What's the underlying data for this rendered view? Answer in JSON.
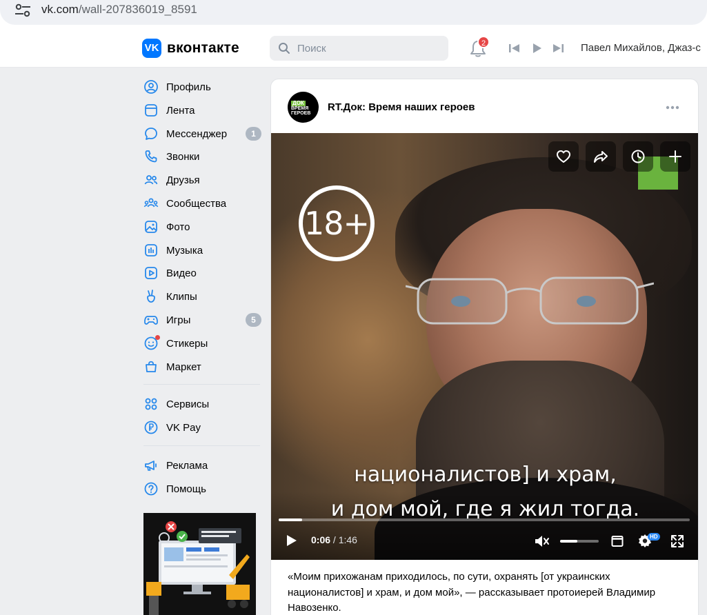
{
  "browser": {
    "url_host": "vk.com",
    "url_path": "/wall-207836019_8591"
  },
  "header": {
    "logo_glyph": "VK",
    "wordmark": "вконтакте",
    "search_placeholder": "Поиск",
    "notifications_count": "2",
    "now_playing": "Павел Михайлов, Джаз-с"
  },
  "sidebar": {
    "items": [
      {
        "label": "Профиль",
        "icon": "user-circle-icon"
      },
      {
        "label": "Лента",
        "icon": "newsfeed-icon"
      },
      {
        "label": "Мессенджер",
        "icon": "message-icon",
        "count": "1"
      },
      {
        "label": "Звонки",
        "icon": "phone-icon"
      },
      {
        "label": "Друзья",
        "icon": "friends-icon"
      },
      {
        "label": "Сообщества",
        "icon": "communities-icon"
      },
      {
        "label": "Фото",
        "icon": "photo-icon"
      },
      {
        "label": "Музыка",
        "icon": "music-icon"
      },
      {
        "label": "Видео",
        "icon": "video-icon"
      },
      {
        "label": "Клипы",
        "icon": "clips-icon"
      },
      {
        "label": "Игры",
        "icon": "games-icon",
        "count": "5"
      },
      {
        "label": "Стикеры",
        "icon": "stickers-icon"
      },
      {
        "label": "Маркет",
        "icon": "market-icon"
      }
    ],
    "items2": [
      {
        "label": "Сервисы",
        "icon": "services-icon"
      },
      {
        "label": "VK Pay",
        "icon": "vkpay-icon"
      }
    ],
    "items3": [
      {
        "label": "Реклама",
        "icon": "megaphone-icon"
      },
      {
        "label": "Помощь",
        "icon": "help-icon"
      }
    ]
  },
  "post": {
    "author": "RT.Док: Время наших героев",
    "avatar_line1": "ДОК",
    "avatar_line2": "ВРЕМЯ ГЕРОЕВ",
    "video": {
      "age_rating": "18+",
      "subtitle_line1": "националистов] и храм,",
      "subtitle_line2": "и дом мой, где я жил тогда.",
      "current_time": "0:06",
      "time_separator": "/",
      "duration": "1:46",
      "progress_fraction": 0.057,
      "volume_fraction": 0.45,
      "quality_badge": "HD"
    },
    "text": "«Моим прихожанам приходилось, по сути, охранять [от украинских националистов] и храм, и дом мой», — рассказывает протоиерей Владимир Навозенко."
  },
  "colors": {
    "vk_blue": "#0077ff",
    "badge_red": "#e64646",
    "count_grey": "#aeb7c2",
    "channel_green": "#6ab33e"
  }
}
